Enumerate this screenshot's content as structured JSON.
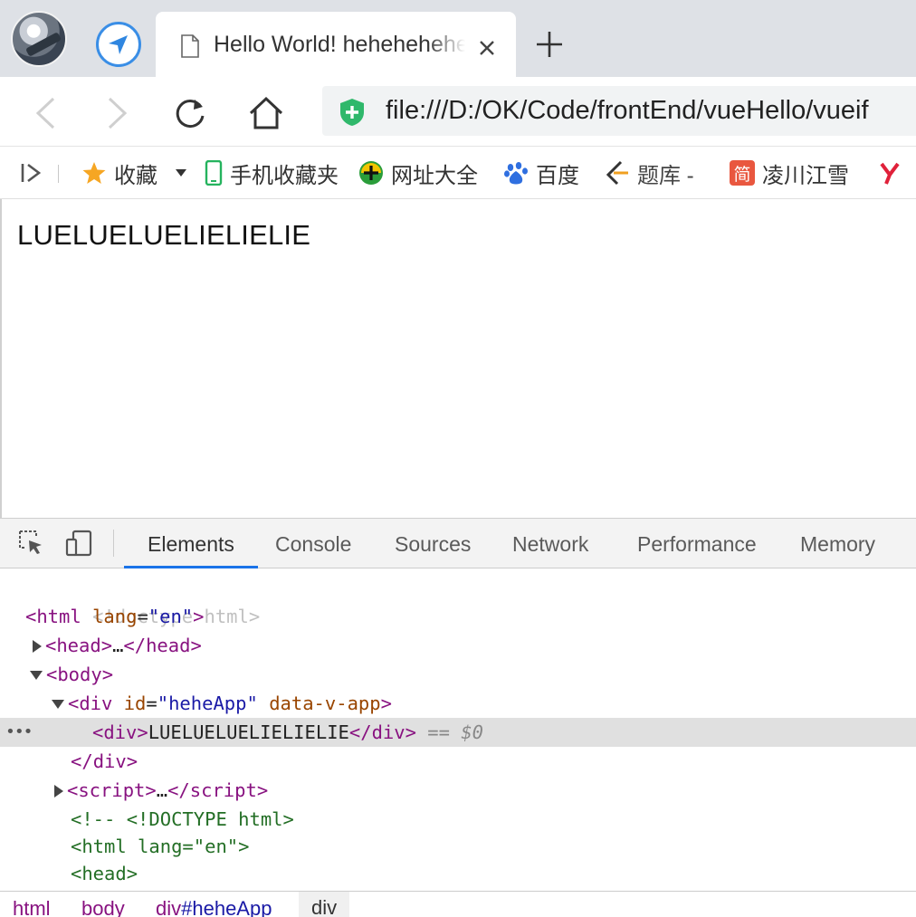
{
  "browser": {
    "tab": {
      "title": "Hello World! hehehehehe"
    },
    "toolbar": {
      "url": "file:///D:/OK/Code/frontEnd/vueHello/vueif"
    },
    "bookmarks": [
      {
        "label": "收藏",
        "icon": "star-icon"
      },
      {
        "label": "手机收藏夹",
        "icon": "phone-icon"
      },
      {
        "label": "网址大全",
        "icon": "url-directory-icon"
      },
      {
        "label": "百度",
        "icon": "baidu-paw-icon"
      },
      {
        "label": "题库 -",
        "icon": "quiz-logo-icon"
      },
      {
        "label": "凌川江雪",
        "icon": "jianshu-icon"
      },
      {
        "label": "",
        "icon": "y-logo-icon"
      }
    ]
  },
  "page": {
    "text": "LUELUELUELIELIELIE"
  },
  "devtools": {
    "tabs": [
      "Elements",
      "Console",
      "Sources",
      "Network",
      "Performance",
      "Memory"
    ],
    "active_tab": "Elements",
    "dom": {
      "doctype": "<!doctype html>",
      "html_tag": "html",
      "lang_attr": "lang",
      "lang_val": "\"en\"",
      "head_tag": "head",
      "body_tag": "body",
      "div_tag": "div",
      "id_attr": "id",
      "id_val": "\"heheApp\"",
      "data_attr": "data-v-app",
      "inner_text": "LUELUELUELIELIELIE",
      "selected_ref": "== $0",
      "script_tag": "script",
      "ellipsis": "…",
      "comment_line": "<!-- <!DOCTYPE html>",
      "comment_html": "<html lang=\"en\">",
      "comment_head": "<head>"
    },
    "breadcrumb": [
      "html",
      "body",
      "div#heheApp",
      "div"
    ],
    "breadcrumb_parts": {
      "div_id_tag": "div",
      "div_id_hash": "#heheApp"
    }
  },
  "colors": {
    "tab_strip": "#dee1e6",
    "active_tab_underline": "#1a73e8",
    "tag": "#881280",
    "attribute": "#994500",
    "attribute_value": "#1a1aa6",
    "comment": "#236e25"
  }
}
